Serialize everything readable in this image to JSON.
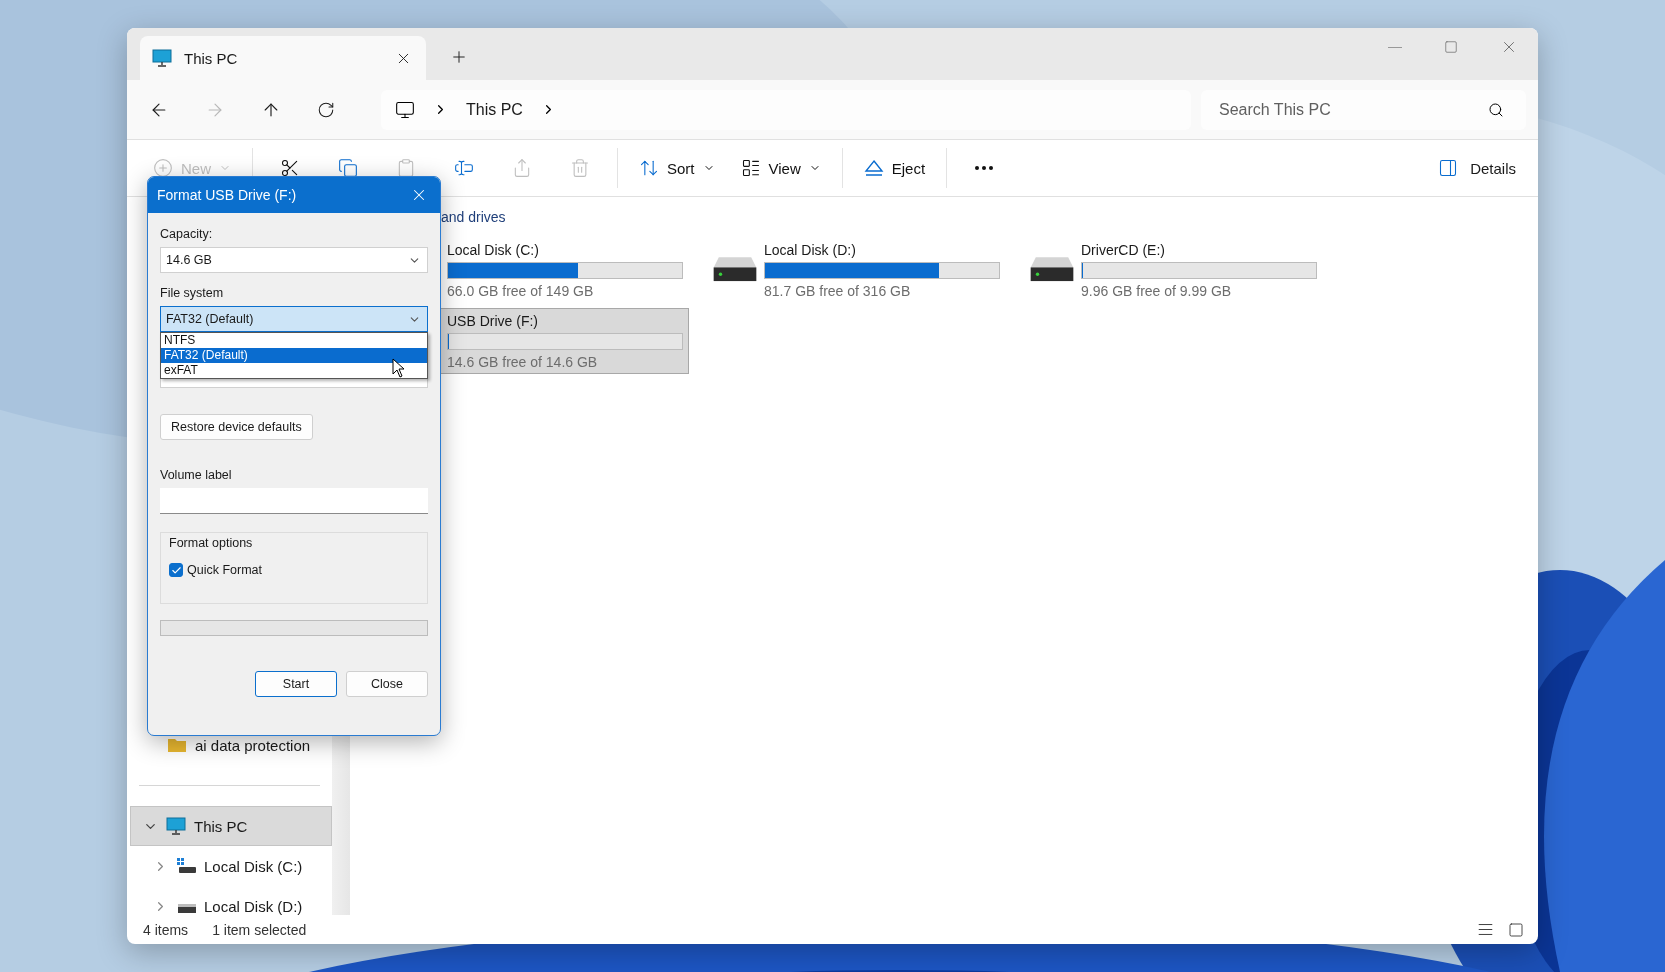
{
  "tab": {
    "title": "This PC",
    "selected": true
  },
  "address": {
    "crumbs": [
      "This PC"
    ]
  },
  "search": {
    "placeholder": "Search This PC"
  },
  "toolbar": [
    {
      "kind": "new",
      "label": "New",
      "disabled": true
    },
    {
      "kind": "separator"
    },
    {
      "kind": "cut",
      "disabled": false
    },
    {
      "kind": "copy",
      "disabled": false
    },
    {
      "kind": "paste",
      "disabled": true
    },
    {
      "kind": "rename",
      "disabled": false
    },
    {
      "kind": "share",
      "disabled": true
    },
    {
      "kind": "delete",
      "disabled": true
    },
    {
      "kind": "separator"
    },
    {
      "kind": "sort",
      "label": "Sort",
      "disabled": false
    },
    {
      "kind": "view",
      "label": "View",
      "disabled": false
    },
    {
      "kind": "separator"
    },
    {
      "kind": "eject",
      "label": "Eject",
      "disabled": false
    },
    {
      "kind": "separator"
    },
    {
      "kind": "more",
      "disabled": false
    }
  ],
  "details": {
    "label": "Details"
  },
  "sidebar": {
    "items": [
      {
        "label": "ai data protection",
        "kind": "folder"
      }
    ],
    "tree": [
      {
        "label": "This PC",
        "kind": "pc",
        "expanded": true,
        "selected": true,
        "children": [
          {
            "label": "Local Disk (C:)",
            "kind": "system-disk",
            "expanded": false,
            "selected": false
          },
          {
            "label": "Local Disk (D:)",
            "kind": "disk",
            "expanded": false,
            "selected": false
          }
        ]
      }
    ]
  },
  "section": {
    "title": "and drives",
    "drives": [
      {
        "name": "Local Disk (C:)",
        "free": "66.0 GB free of 149 GB",
        "level": 0.557,
        "selected": false
      },
      {
        "name": "Local Disk (D:)",
        "free": "81.7 GB free of 316 GB",
        "level": 0.742,
        "selected": false
      },
      {
        "name": "DriverCD (E:)",
        "free": "9.96 GB free of 9.99 GB",
        "level": 0.003,
        "selected": false
      },
      {
        "name": "USB Drive (F:)",
        "free": "14.6 GB free of 14.6 GB",
        "level": 0,
        "selected": true
      }
    ]
  },
  "status": {
    "count": "4 items",
    "selection": "1 item selected",
    "views": [
      {
        "kind": "details"
      },
      {
        "kind": "tiles"
      }
    ]
  },
  "dialog": {
    "title": "Format USB Drive (F:)",
    "capacity_label": "Capacity:",
    "capacity": "14.6 GB",
    "fs_label": "File system",
    "fs": {
      "value": "FAT32 (Default)",
      "expanded": true,
      "options": [
        {
          "label": "NTFS",
          "selected": false
        },
        {
          "label": "FAT32 (Default)",
          "selected": true
        },
        {
          "label": "exFAT",
          "selected": false
        }
      ]
    },
    "restore": "Restore device defaults",
    "volume_label": "Volume label",
    "options_title": "Format options",
    "quick_format": {
      "label": "Quick Format",
      "checked": true
    },
    "buttons": [
      {
        "label": "Start",
        "default": true
      },
      {
        "label": "Close",
        "default": false
      }
    ]
  }
}
